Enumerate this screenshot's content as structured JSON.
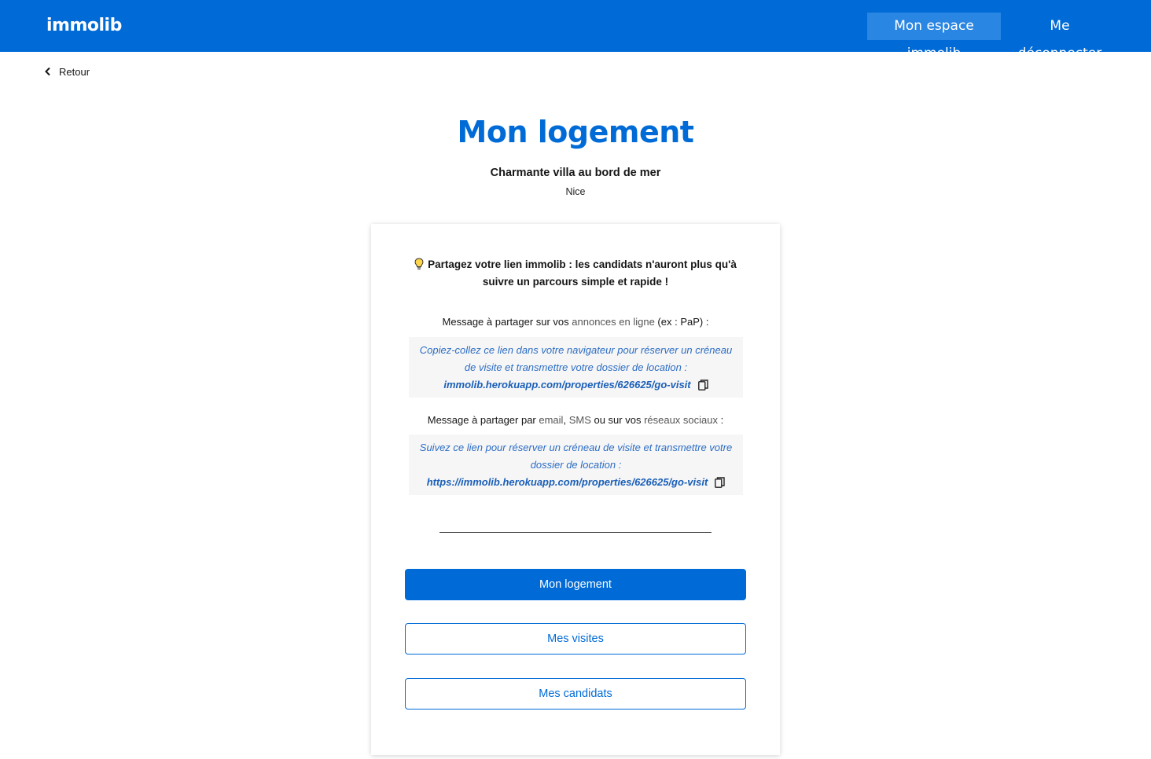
{
  "header": {
    "logo": "immolib",
    "nav": {
      "espace_label": "Mon espace immolib",
      "logout_label": "Me déconnecter"
    }
  },
  "back": {
    "label": "Retour"
  },
  "page": {
    "title": "Mon logement",
    "property_name": "Charmante villa au bord de mer",
    "city": "Nice"
  },
  "share": {
    "tip": "Partagez votre lien immolib : les candidats n'auront plus qu'à suivre un parcours simple et rapide !",
    "online": {
      "label_prefix": "Message à partager sur vos ",
      "label_muted": "annonces en ligne",
      "label_suffix": " (ex : PaP) :",
      "text": "Copiez-collez ce lien dans votre navigateur pour réserver un créneau de visite et transmettre votre dossier de location :",
      "link": "immolib.herokuapp.com/properties/626625/go-visit"
    },
    "social": {
      "label_prefix": "Message à partager par ",
      "label_muted1": "email",
      "label_sep": ", ",
      "label_muted2": "SMS",
      "label_mid": " ou sur vos ",
      "label_muted3": "réseaux sociaux",
      "label_suffix": " :",
      "text": "Suivez ce lien pour réserver un créneau de visite et transmettre votre dossier de location :",
      "link": "https://immolib.herokuapp.com/properties/626625/go-visit"
    }
  },
  "buttons": {
    "logement": "Mon logement",
    "visites": "Mes visites",
    "candidats": "Mes candidats"
  },
  "colors": {
    "brand": "#006bd6",
    "nav_active": "#2a86e3",
    "message_bg": "#f6f6f6",
    "link": "#1b5fb8"
  },
  "icons": [
    "chevron-left-icon",
    "lightbulb-icon",
    "copy-icon"
  ]
}
